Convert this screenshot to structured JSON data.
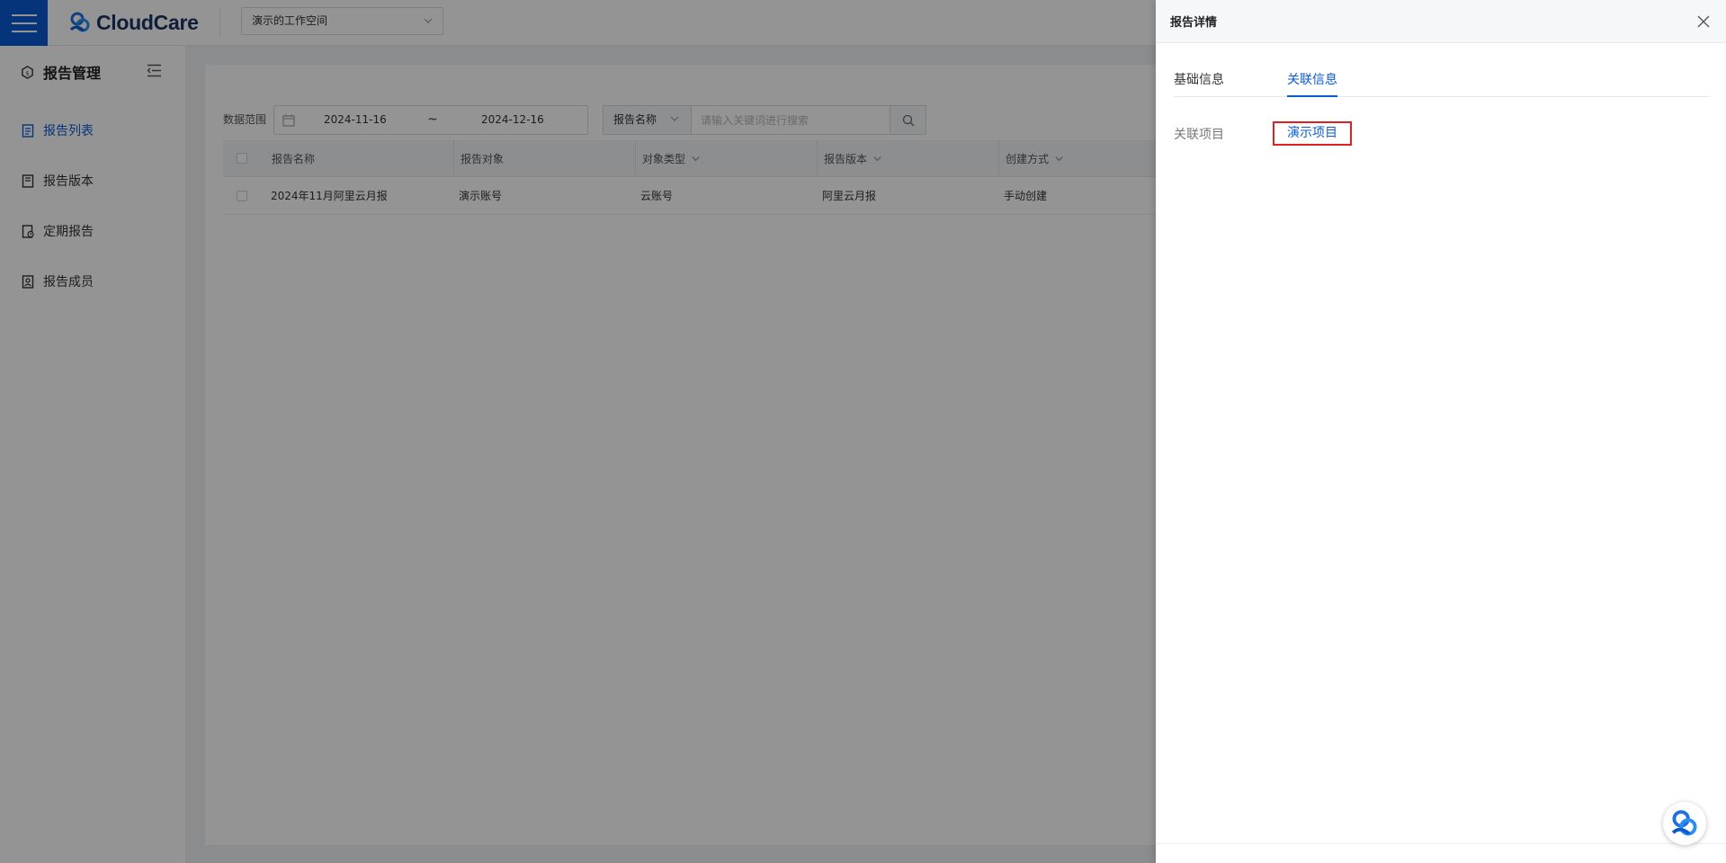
{
  "topbar": {
    "logo_text": "CloudCare",
    "workspace": "演示的工作空间"
  },
  "sidebar": {
    "title": "报告管理",
    "items": [
      {
        "label": "报告列表",
        "icon": "document-list-icon",
        "active": true
      },
      {
        "label": "报告版本",
        "icon": "book-icon",
        "active": false
      },
      {
        "label": "定期报告",
        "icon": "scheduled-report-icon",
        "active": false
      },
      {
        "label": "报告成员",
        "icon": "members-icon",
        "active": false
      }
    ]
  },
  "filters": {
    "range_label": "数据范围",
    "date_start": "2024-11-16",
    "date_separator": "~",
    "date_end": "2024-12-16",
    "field_select": "报告名称",
    "search_placeholder": "请输入关键词进行搜索"
  },
  "table": {
    "headers": [
      "报告名称",
      "报告对象",
      "对象类型",
      "报告版本",
      "创建方式"
    ],
    "rows": [
      [
        "2024年11月阿里云月报",
        "演示账号",
        "云账号",
        "阿里云月报",
        "手动创建"
      ]
    ]
  },
  "drawer": {
    "title": "报告详情",
    "tabs": [
      {
        "label": "基础信息",
        "active": false
      },
      {
        "label": "关联信息",
        "active": true
      }
    ],
    "related_label": "关联项目",
    "related_value": "演示项目"
  },
  "colors": {
    "accent": "#0a5bd3",
    "highlight_border": "#e02020"
  }
}
